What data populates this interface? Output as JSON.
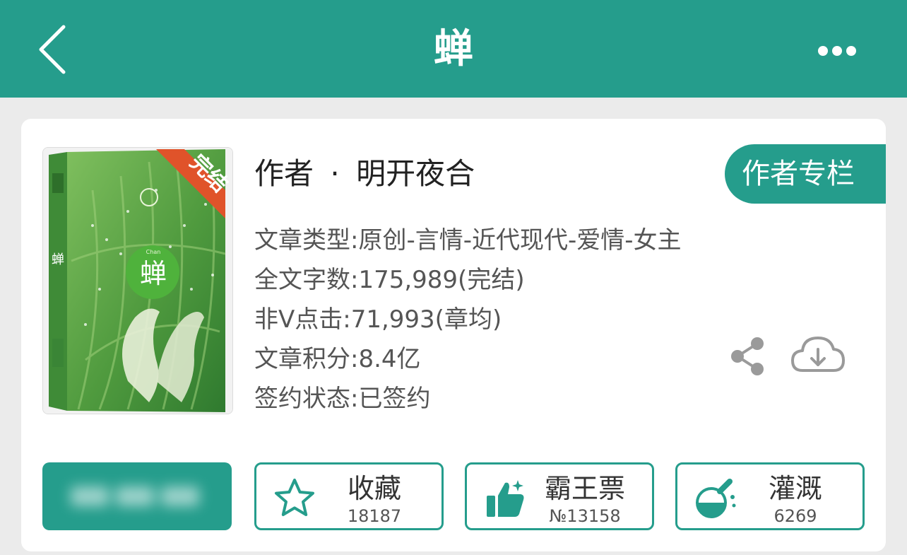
{
  "header": {
    "title": "蝉",
    "back_icon": "chevron-left-icon",
    "more_icon": "more-dots-icon"
  },
  "book": {
    "cover": {
      "title": "蝉",
      "title_small": "Chan",
      "badge": "完结",
      "spine_title": "蝉"
    },
    "author_prefix": "作者",
    "author_sep": "·",
    "author_name": "明开夜合",
    "author_column_label": "作者专栏",
    "meta": [
      "文章类型:原创-言情-近代现代-爱情-女主",
      "全文字数:175,989(完结)",
      "非Ⅴ点击:71,993(章均)",
      "文章积分:8.4亿",
      "签约状态:已签约"
    ]
  },
  "actions": {
    "collect": {
      "label": "收藏",
      "count": "18187",
      "icon": "star-icon"
    },
    "vote": {
      "label": "霸王票",
      "count": "№13158",
      "icon": "thumbs-up-icon"
    },
    "nutrient": {
      "label": "灌溉",
      "count": "6269",
      "icon": "flask-icon"
    }
  },
  "colors": {
    "primary": "#259d8c",
    "background": "#ebebeb",
    "badge": "#e0532a",
    "cover_green": "#5fa54a"
  }
}
